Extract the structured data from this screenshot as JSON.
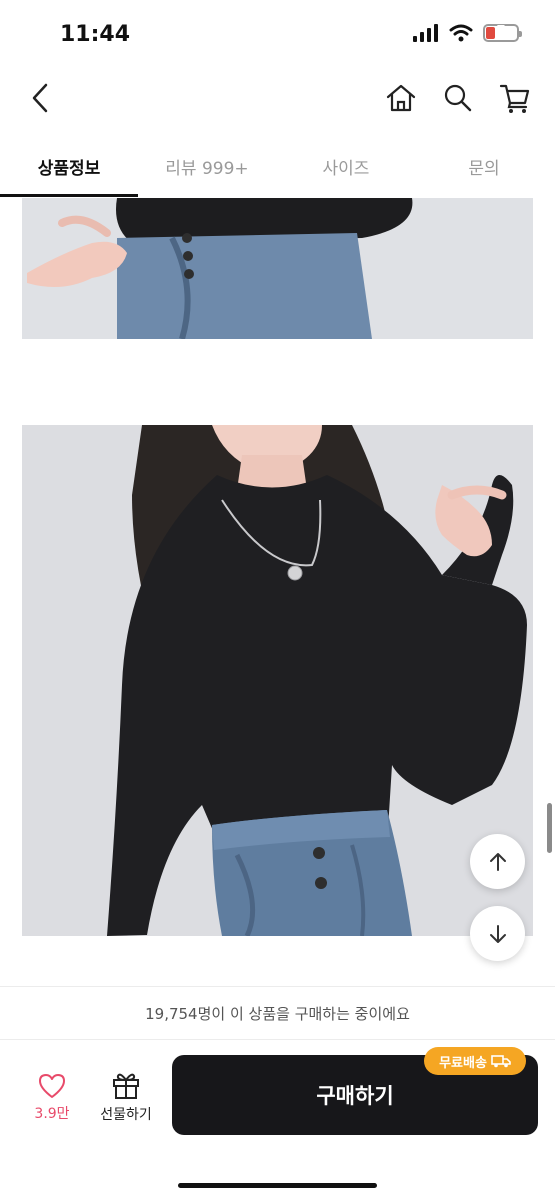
{
  "status": {
    "time": "11:44",
    "battery": "7"
  },
  "tabs": [
    {
      "label": "상품정보"
    },
    {
      "label": "리뷰 999+"
    },
    {
      "label": "사이즈"
    },
    {
      "label": "문의"
    }
  ],
  "bottom": {
    "notice": "19,754명이 이 상품을 구매하는 중이에요",
    "like_count": "3.9만",
    "gift_label": "선물하기",
    "buy_label": "구매하기",
    "free_shipping": "무료배송"
  },
  "colors": {
    "accent": "#e84a6a",
    "badge": "#f5a623",
    "buy_button": "#17171a"
  }
}
